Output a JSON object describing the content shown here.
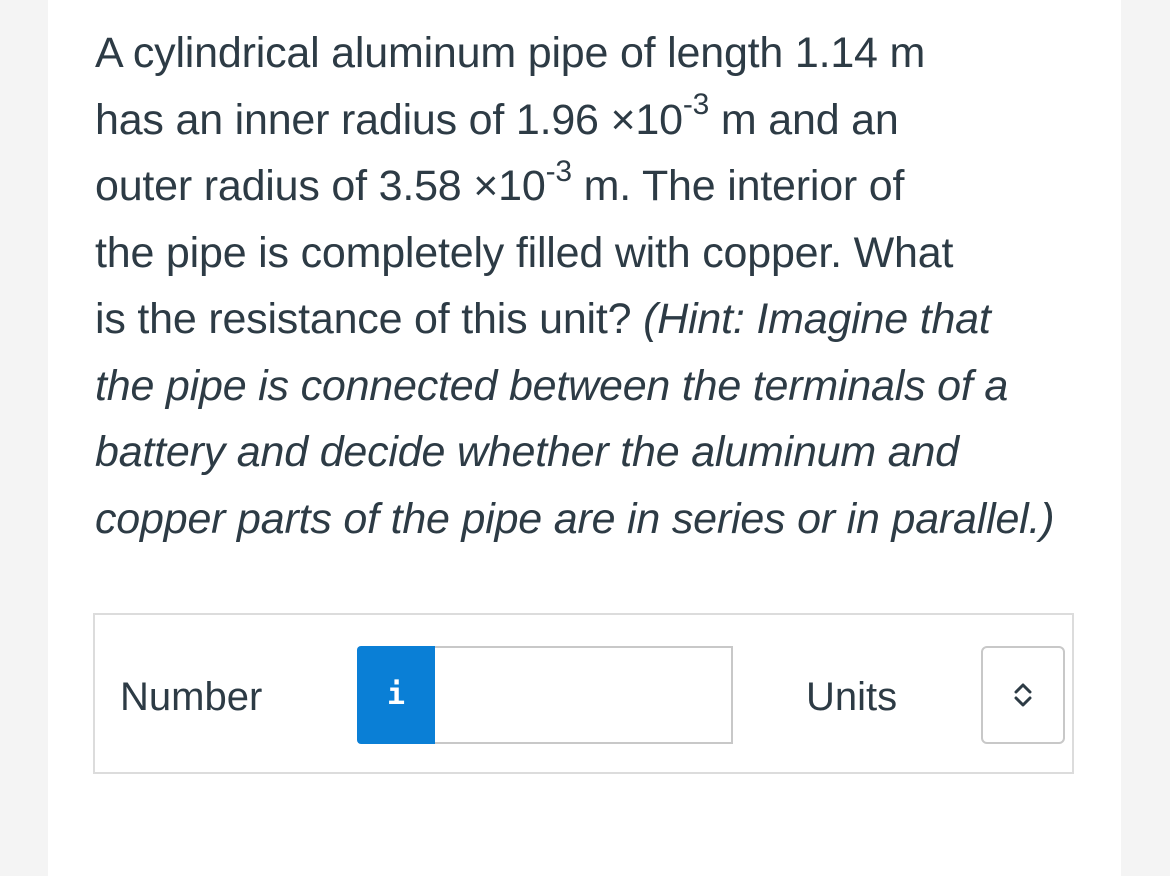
{
  "question": {
    "line1": "A cylindrical aluminum pipe of length 1.14 m",
    "line2_pre": "has an inner radius of 1.96 ×10",
    "line2_exp": "-3",
    "line2_post": " m and an",
    "line3_pre": "outer radius of 3.58 ×10",
    "line3_exp": "-3",
    "line3_post": " m. The interior of",
    "line4": "the pipe is completely filled with copper. What",
    "line5_pre": "is the resistance of this unit? ",
    "line5_hint": "(Hint: Imagine that",
    "line6": "the pipe is connected between the terminals of a",
    "line7": "battery and decide whether the aluminum and",
    "line8": "copper parts of the pipe are in series or in parallel.)"
  },
  "answer": {
    "number_label": "Number",
    "info_button_label": "i",
    "number_value": "",
    "units_label": "Units",
    "units_selected": "",
    "info_icon": "info-icon",
    "units_icon": "chevron-up-down-icon"
  },
  "colors": {
    "text": "#2d3b45",
    "accent": "#0a7fd6",
    "border": "#c8c8c8",
    "background": "#f4f4f4",
    "card": "#ffffff"
  }
}
